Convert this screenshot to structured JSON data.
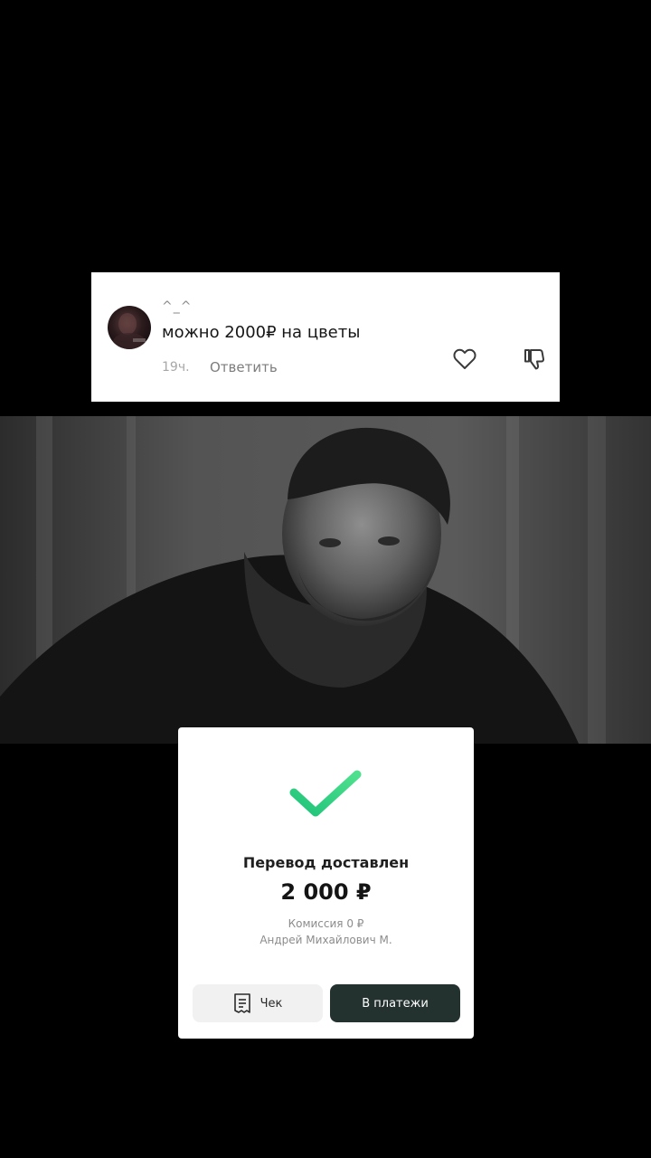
{
  "comment": {
    "username": "^_^",
    "text": "можно 2000₽ на цветы",
    "time": "19ч.",
    "reply_label": "Ответить",
    "like_icon": "heart-icon",
    "dislike_icon": "thumbs-down-icon"
  },
  "photo": {
    "subject": "photo"
  },
  "transfer": {
    "status_icon": "checkmark-icon",
    "accent_color": "#2ed27a",
    "title": "Перевод доставлен",
    "amount": "2 000 ₽",
    "fee": "Комиссия 0 ₽",
    "recipient": "Андрей Михайлович М.",
    "receipt_button": {
      "label": "Чек",
      "icon": "receipt-icon"
    },
    "payments_button": {
      "label": "В платежи",
      "color": "#24322f"
    }
  }
}
